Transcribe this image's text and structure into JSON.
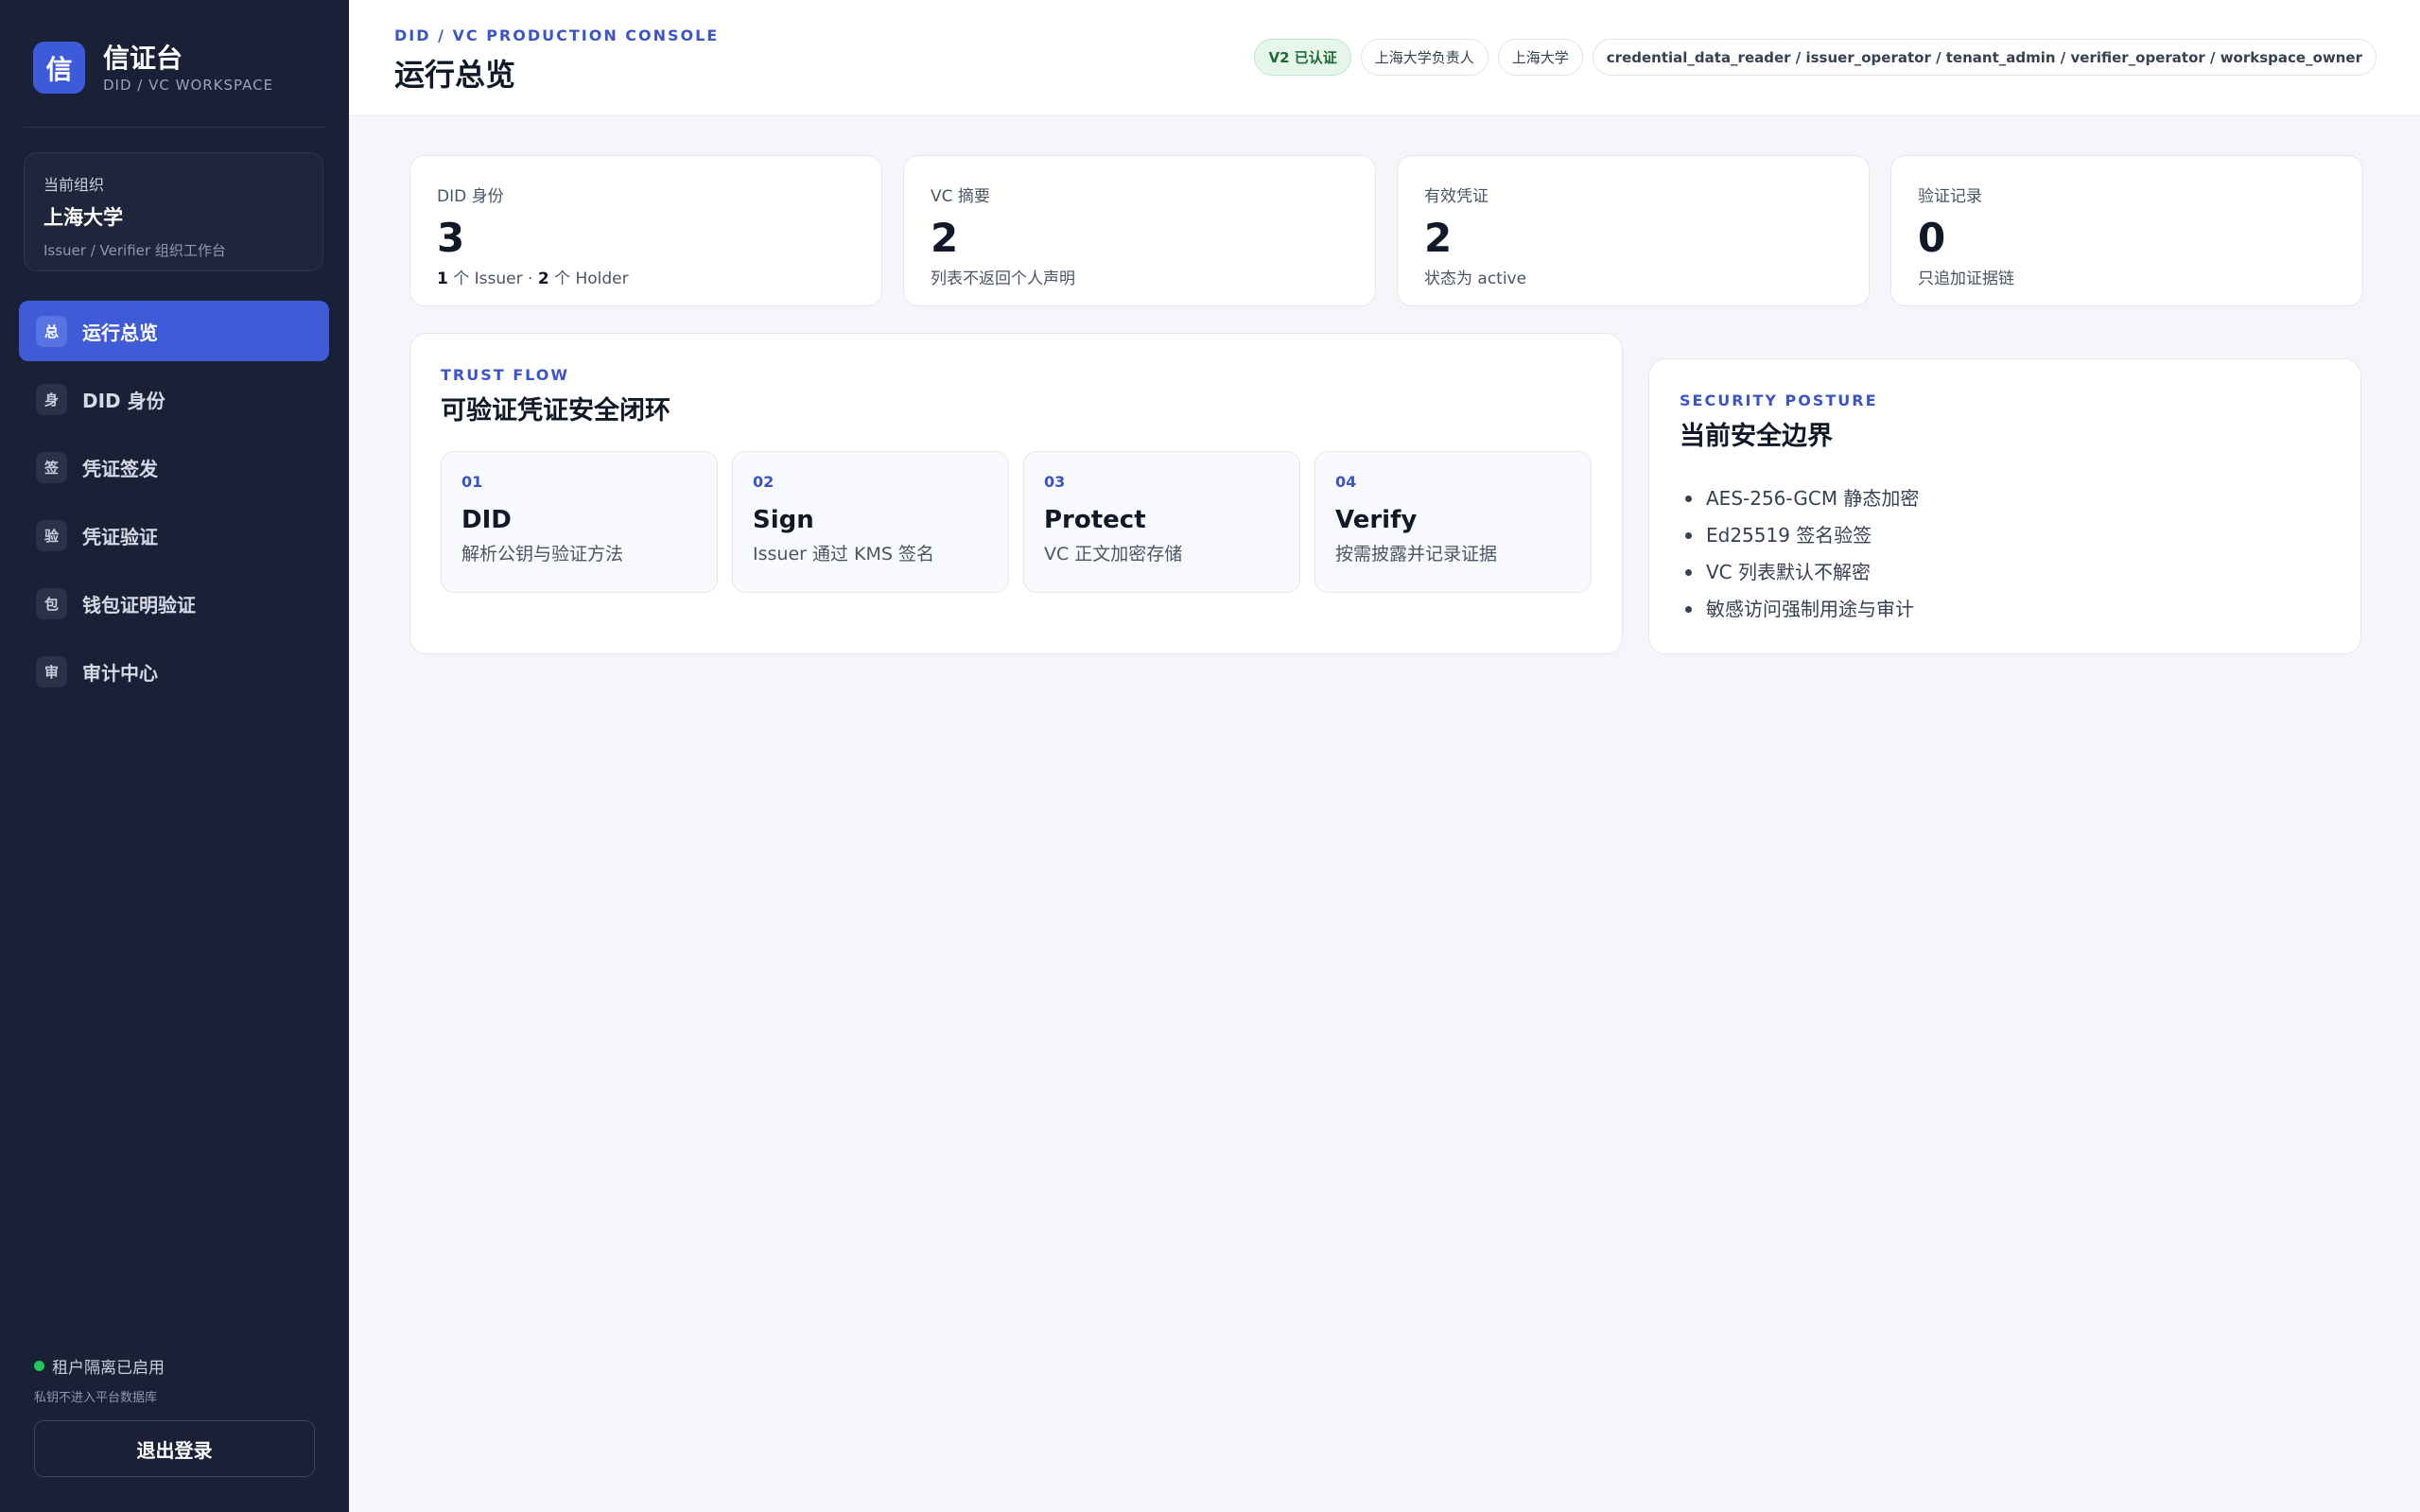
{
  "brand": {
    "logo_char": "信",
    "title": "信证台",
    "subtitle": "DID / VC WORKSPACE"
  },
  "org": {
    "label": "当前组织",
    "name": "上海大学",
    "desc": "Issuer / Verifier 组织工作台"
  },
  "nav": [
    {
      "badge": "总",
      "label": "运行总览",
      "active": true
    },
    {
      "badge": "身",
      "label": "DID 身份",
      "active": false
    },
    {
      "badge": "签",
      "label": "凭证签发",
      "active": false
    },
    {
      "badge": "验",
      "label": "凭证验证",
      "active": false
    },
    {
      "badge": "包",
      "label": "钱包证明验证",
      "active": false
    },
    {
      "badge": "审",
      "label": "审计中心",
      "active": false
    }
  ],
  "isolation": {
    "title": "租户隔离已启用",
    "subtitle": "私钥不进入平台数据库",
    "color": "#22c55e"
  },
  "logout_label": "退出登录",
  "header": {
    "eyebrow": "DID / VC PRODUCTION CONSOLE",
    "title": "运行总览",
    "tags": {
      "verified": "V2 已认证",
      "owner": "上海大学负责人",
      "org": "上海大学",
      "roles": "credential_data_reader / issuer_operator / tenant_admin / verifier_operator / workspace_owner"
    }
  },
  "stats": [
    {
      "label": "DID 身份",
      "value": "3",
      "note_parts": [
        "1",
        " 个 Issuer · ",
        "2",
        " 个 Holder"
      ]
    },
    {
      "label": "VC 摘要",
      "value": "2",
      "note": "列表不返回个人声明"
    },
    {
      "label": "有效凭证",
      "value": "2",
      "note": "状态为 active"
    },
    {
      "label": "验证记录",
      "value": "0",
      "note": "只追加证据链"
    }
  ],
  "trust_flow": {
    "eyebrow": "TRUST FLOW",
    "title": "可验证凭证安全闭环",
    "steps": [
      {
        "num": "01",
        "title": "DID",
        "desc": "解析公钥与验证方法"
      },
      {
        "num": "02",
        "title": "Sign",
        "desc": "Issuer 通过 KMS 签名"
      },
      {
        "num": "03",
        "title": "Protect",
        "desc": "VC 正文加密存储"
      },
      {
        "num": "04",
        "title": "Verify",
        "desc": "按需披露并记录证据"
      }
    ]
  },
  "posture": {
    "eyebrow": "SECURITY POSTURE",
    "title": "当前安全边界",
    "items": [
      "AES-256-GCM 静态加密",
      "Ed25519 签名验签",
      "VC 列表默认不解密",
      "敏感访问强制用途与审计"
    ]
  },
  "colors": {
    "accent": "#3f5bd8",
    "sidebar": "#1a2035",
    "verified_bg": "#e6f6ea"
  }
}
